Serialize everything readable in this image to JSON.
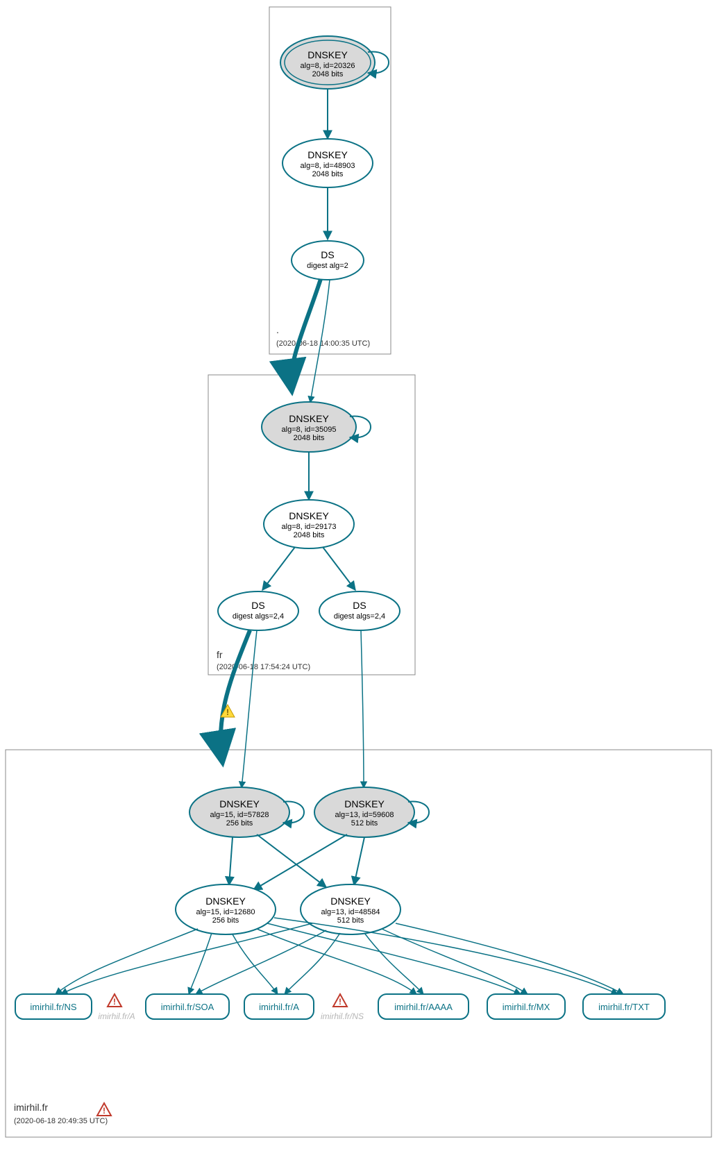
{
  "chart_data": {
    "type": "graph",
    "description": "DNSSEC authentication chain graph for imirhil.fr showing DNSKEY, DS records and signed RRsets across three zones (root, fr, imirhil.fr).",
    "zones": [
      {
        "name": ".",
        "timestamp": "(2020-06-18 14:00:35 UTC)",
        "nodes": [
          {
            "id": "root_ksk",
            "type": "DNSKEY",
            "title": "DNSKEY",
            "sub1": "alg=8, id=20326",
            "sub2": "2048 bits",
            "style": "grey-double",
            "selfloop": true
          },
          {
            "id": "root_zsk",
            "type": "DNSKEY",
            "title": "DNSKEY",
            "sub1": "alg=8, id=48903",
            "sub2": "2048 bits",
            "style": "white"
          },
          {
            "id": "root_ds",
            "type": "DS",
            "title": "DS",
            "sub1": "digest alg=2",
            "style": "white"
          }
        ],
        "edges": [
          {
            "from": "root_ksk",
            "to": "root_zsk"
          },
          {
            "from": "root_zsk",
            "to": "root_ds"
          }
        ]
      },
      {
        "name": "fr",
        "timestamp": "(2020-06-18 17:54:24 UTC)",
        "nodes": [
          {
            "id": "fr_ksk",
            "type": "DNSKEY",
            "title": "DNSKEY",
            "sub1": "alg=8, id=35095",
            "sub2": "2048 bits",
            "style": "grey",
            "selfloop": true
          },
          {
            "id": "fr_zsk",
            "type": "DNSKEY",
            "title": "DNSKEY",
            "sub1": "alg=8, id=29173",
            "sub2": "2048 bits",
            "style": "white"
          },
          {
            "id": "fr_ds1",
            "type": "DS",
            "title": "DS",
            "sub1": "digest algs=2,4",
            "style": "white"
          },
          {
            "id": "fr_ds2",
            "type": "DS",
            "title": "DS",
            "sub1": "digest algs=2,4",
            "style": "white"
          }
        ],
        "edges": [
          {
            "from": "root_ds",
            "to": "fr_ksk",
            "style": "thick",
            "interzone": true
          },
          {
            "from": "fr_ksk",
            "to": "fr_zsk"
          },
          {
            "from": "fr_zsk",
            "to": "fr_ds1"
          },
          {
            "from": "fr_zsk",
            "to": "fr_ds2"
          }
        ]
      },
      {
        "name": "imirhil.fr",
        "timestamp": "(2020-06-18 20:49:35 UTC)",
        "zone_warning": true,
        "nodes": [
          {
            "id": "im_ksk1",
            "type": "DNSKEY",
            "title": "DNSKEY",
            "sub1": "alg=15, id=57828",
            "sub2": "256 bits",
            "style": "grey",
            "selfloop": true
          },
          {
            "id": "im_ksk2",
            "type": "DNSKEY",
            "title": "DNSKEY",
            "sub1": "alg=13, id=59608",
            "sub2": "512 bits",
            "style": "grey",
            "selfloop": true
          },
          {
            "id": "im_zsk1",
            "type": "DNSKEY",
            "title": "DNSKEY",
            "sub1": "alg=15, id=12680",
            "sub2": "256 bits",
            "style": "white"
          },
          {
            "id": "im_zsk2",
            "type": "DNSKEY",
            "title": "DNSKEY",
            "sub1": "alg=13, id=48584",
            "sub2": "512 bits",
            "style": "white"
          }
        ],
        "rrsets": [
          {
            "id": "rr_ns",
            "label": "imirhil.fr/NS"
          },
          {
            "id": "rr_a_grey",
            "label": "imirhil.fr/A",
            "warning": true,
            "style": "grey"
          },
          {
            "id": "rr_soa",
            "label": "imirhil.fr/SOA"
          },
          {
            "id": "rr_a",
            "label": "imirhil.fr/A"
          },
          {
            "id": "rr_ns_grey",
            "label": "imirhil.fr/NS",
            "warning": true,
            "style": "grey"
          },
          {
            "id": "rr_aaaa",
            "label": "imirhil.fr/AAAA"
          },
          {
            "id": "rr_mx",
            "label": "imirhil.fr/MX"
          },
          {
            "id": "rr_txt",
            "label": "imirhil.fr/TXT"
          }
        ],
        "edges": [
          {
            "from": "fr_ds1",
            "to": "im_ksk1",
            "style": "thick",
            "interzone": true,
            "warning": true
          },
          {
            "from": "fr_ds2",
            "to": "im_ksk2",
            "interzone": true
          },
          {
            "from": "im_ksk1",
            "to": "im_zsk1"
          },
          {
            "from": "im_ksk1",
            "to": "im_zsk2"
          },
          {
            "from": "im_ksk2",
            "to": "im_zsk1"
          },
          {
            "from": "im_ksk2",
            "to": "im_zsk2"
          },
          {
            "from": "im_zsk1",
            "to": "rr_ns"
          },
          {
            "from": "im_zsk1",
            "to": "rr_soa"
          },
          {
            "from": "im_zsk1",
            "to": "rr_a"
          },
          {
            "from": "im_zsk1",
            "to": "rr_aaaa"
          },
          {
            "from": "im_zsk1",
            "to": "rr_mx"
          },
          {
            "from": "im_zsk1",
            "to": "rr_txt"
          },
          {
            "from": "im_zsk2",
            "to": "rr_ns"
          },
          {
            "from": "im_zsk2",
            "to": "rr_soa"
          },
          {
            "from": "im_zsk2",
            "to": "rr_a"
          },
          {
            "from": "im_zsk2",
            "to": "rr_aaaa"
          },
          {
            "from": "im_zsk2",
            "to": "rr_mx"
          },
          {
            "from": "im_zsk2",
            "to": "rr_txt"
          }
        ]
      }
    ]
  },
  "labels": {
    "root_ksk_title": "DNSKEY",
    "root_ksk_sub1": "alg=8, id=20326",
    "root_ksk_sub2": "2048 bits",
    "root_zsk_title": "DNSKEY",
    "root_zsk_sub1": "alg=8, id=48903",
    "root_zsk_sub2": "2048 bits",
    "root_ds_title": "DS",
    "root_ds_sub1": "digest alg=2",
    "zone_root_name": ".",
    "zone_root_ts": "(2020-06-18 14:00:35 UTC)",
    "fr_ksk_title": "DNSKEY",
    "fr_ksk_sub1": "alg=8, id=35095",
    "fr_ksk_sub2": "2048 bits",
    "fr_zsk_title": "DNSKEY",
    "fr_zsk_sub1": "alg=8, id=29173",
    "fr_zsk_sub2": "2048 bits",
    "fr_ds1_title": "DS",
    "fr_ds1_sub1": "digest algs=2,4",
    "fr_ds2_title": "DS",
    "fr_ds2_sub1": "digest algs=2,4",
    "zone_fr_name": "fr",
    "zone_fr_ts": "(2020-06-18 17:54:24 UTC)",
    "im_ksk1_title": "DNSKEY",
    "im_ksk1_sub1": "alg=15, id=57828",
    "im_ksk1_sub2": "256 bits",
    "im_ksk2_title": "DNSKEY",
    "im_ksk2_sub1": "alg=13, id=59608",
    "im_ksk2_sub2": "512 bits",
    "im_zsk1_title": "DNSKEY",
    "im_zsk1_sub1": "alg=15, id=12680",
    "im_zsk1_sub2": "256 bits",
    "im_zsk2_title": "DNSKEY",
    "im_zsk2_sub1": "alg=13, id=48584",
    "im_zsk2_sub2": "512 bits",
    "zone_im_name": "imirhil.fr",
    "zone_im_ts": "(2020-06-18 20:49:35 UTC)",
    "rr_ns": "imirhil.fr/NS",
    "rr_a_grey": "imirhil.fr/A",
    "rr_soa": "imirhil.fr/SOA",
    "rr_a": "imirhil.fr/A",
    "rr_ns_grey": "imirhil.fr/NS",
    "rr_aaaa": "imirhil.fr/AAAA",
    "rr_mx": "imirhil.fr/MX",
    "rr_txt": "imirhil.fr/TXT"
  }
}
